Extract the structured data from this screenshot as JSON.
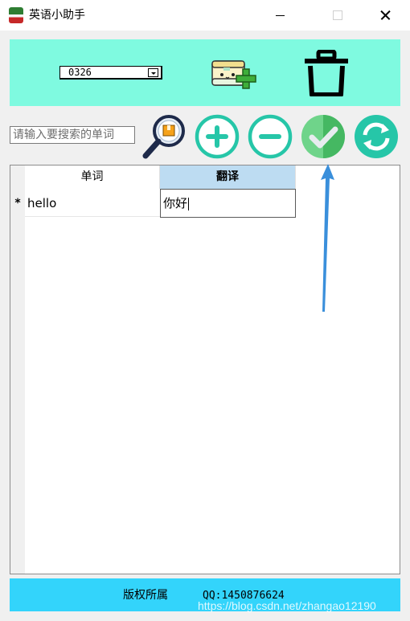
{
  "window": {
    "title": "英语小助手"
  },
  "top_panel": {
    "background": "#7ffae0",
    "dropdown": {
      "selected": "0326"
    },
    "add_book_icon": "add-book-icon",
    "trash_icon": "trash-icon"
  },
  "search": {
    "placeholder": "请输入要搜索的单词",
    "value": ""
  },
  "toolbar": {
    "icons": [
      "search-icon",
      "add-icon",
      "remove-icon",
      "confirm-icon",
      "refresh-icon"
    ],
    "colors": {
      "teal": "#26c6a8",
      "confirm_green": "#5ec97a"
    }
  },
  "grid": {
    "columns": [
      "单词",
      "翻译"
    ],
    "rows": [
      {
        "marker": "*",
        "word": "hello",
        "translation": "你好"
      }
    ],
    "selected_header_color": "#bddcf2"
  },
  "annotation": {
    "arrow_color": "#3a8fdb"
  },
  "footer": {
    "copyright": "版权所属",
    "qq": "QQ:1450876624",
    "background": "#33d4fb"
  },
  "watermark": "https://blog.csdn.net/zhangao12190"
}
